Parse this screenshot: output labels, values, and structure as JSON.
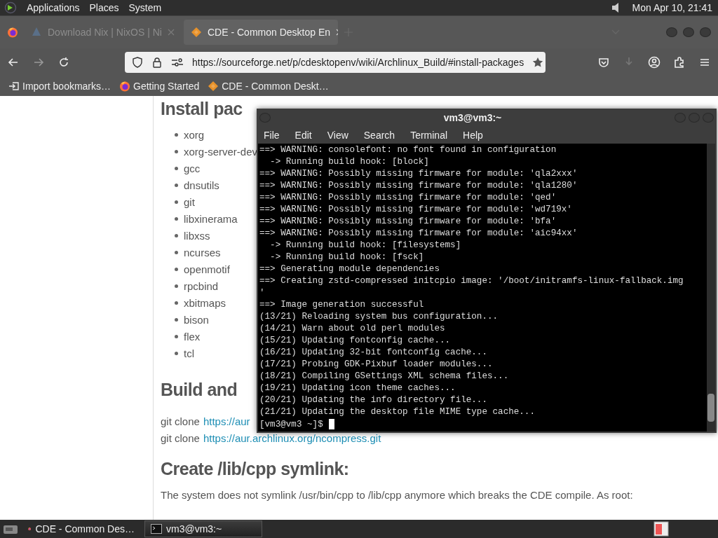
{
  "top_panel": {
    "menus": [
      "Applications",
      "Places",
      "System"
    ],
    "clock": "Mon Apr 10, 21:41"
  },
  "browser": {
    "tabs": [
      {
        "title": "Download Nix | NixOS | Ni",
        "selected": false
      },
      {
        "title": "CDE - Common Desktop En",
        "selected": true
      }
    ],
    "url": "https://sourceforge.net/p/cdesktopenv/wiki/Archlinux_Build/#install-packages",
    "bookmarks": [
      "Import bookmarks…",
      "Getting Started",
      "CDE - Common Deskt…"
    ]
  },
  "page": {
    "heading_1": "Install pac",
    "packages": [
      "xorg",
      "xorg-server-dev",
      "gcc",
      "dnsutils",
      "git",
      "libxinerama",
      "libxss",
      "ncurses",
      "openmotif",
      "rpcbind",
      "xbitmaps",
      "bison",
      "flex",
      "tcl"
    ],
    "heading_2": "Build and",
    "clone_lines": [
      {
        "text": "git clone",
        "link": "https://aur"
      },
      {
        "text": "git clone",
        "link": "https://aur.archlinux.org/ncompress.git"
      }
    ],
    "heading_3": "Create /lib/cpp symlink:",
    "paragraph": "The system does not symlink /usr/bin/cpp to /lib/cpp anymore which breaks the CDE compile. As root:"
  },
  "terminal": {
    "title": "vm3@vm3:~",
    "menus": [
      "File",
      "Edit",
      "View",
      "Search",
      "Terminal",
      "Help"
    ],
    "lines": [
      "==> WARNING: consolefont: no font found in configuration",
      "  -> Running build hook: [block]",
      "==> WARNING: Possibly missing firmware for module: 'qla2xxx'",
      "==> WARNING: Possibly missing firmware for module: 'qla1280'",
      "==> WARNING: Possibly missing firmware for module: 'qed'",
      "==> WARNING: Possibly missing firmware for module: 'wd719x'",
      "==> WARNING: Possibly missing firmware for module: 'bfa'",
      "==> WARNING: Possibly missing firmware for module: 'aic94xx'",
      "  -> Running build hook: [filesystems]",
      "  -> Running build hook: [fsck]",
      "==> Generating module dependencies",
      "==> Creating zstd-compressed initcpio image: '/boot/initramfs-linux-fallback.img",
      "'",
      "==> Image generation successful",
      "(13/21) Reloading system bus configuration...",
      "(14/21) Warn about old perl modules",
      "(15/21) Updating fontconfig cache...",
      "(16/21) Updating 32-bit fontconfig cache...",
      "(17/21) Probing GDK-Pixbuf loader modules...",
      "(18/21) Compiling GSettings XML schema files...",
      "(19/21) Updating icon theme caches...",
      "(20/21) Updating the info directory file...",
      "(21/21) Updating the desktop file MIME type cache..."
    ],
    "prompt": "[vm3@vm3 ~]$"
  },
  "taskbar": {
    "tasks": [
      {
        "title": "CDE - Common Des…",
        "selected": false
      },
      {
        "title": "vm3@vm3:~",
        "selected": true
      }
    ]
  }
}
